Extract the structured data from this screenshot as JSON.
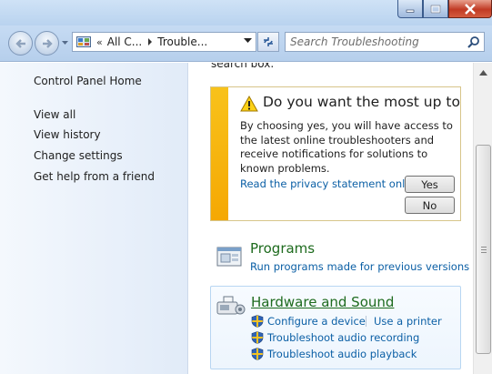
{
  "window": {
    "minimize_icon": "minimize-icon",
    "maximize_icon": "maximize-icon",
    "close_icon": "close-icon"
  },
  "nav": {
    "back_icon": "back-arrow-icon",
    "forward_icon": "forward-arrow-icon",
    "breadcrumb": {
      "overflow": "«",
      "seg1": "All C...",
      "seg2": "Trouble..."
    },
    "search_placeholder": "Search Troubleshooting"
  },
  "sidebar": {
    "home": "Control Panel Home",
    "items": [
      "View all",
      "View history",
      "Change settings",
      "Get help from a friend"
    ]
  },
  "main": {
    "cut_text": "search box.",
    "notice": {
      "title": "Do you want the most up to d...",
      "body": "By choosing yes, you will have access to the latest online troubleshooters and receive notifications for solutions to known problems.",
      "privacy_link": "Read the privacy statement online",
      "yes": "Yes",
      "no": "No"
    },
    "programs": {
      "title": "Programs",
      "link": "Run programs made for previous versions of"
    },
    "hardware": {
      "title": "Hardware and Sound",
      "links": [
        "Configure a device",
        "Use a printer",
        "Troubleshoot audio recording",
        "Troubleshoot audio playback"
      ]
    }
  },
  "colors": {
    "accent_link": "#0b5fa5",
    "category_title": "#1e6b1e",
    "notice_bar": "#f5a803"
  }
}
